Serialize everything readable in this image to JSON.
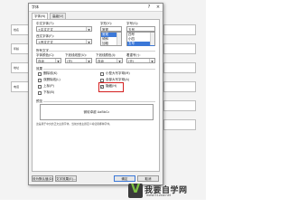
{
  "dialog": {
    "title": "字体",
    "help_btn": "?",
    "close_btn": "×",
    "tabs": [
      {
        "label": "字体(N)"
      },
      {
        "label": "高级(V)"
      }
    ]
  },
  "font_section": {
    "cjk_font_label": "中文字体(T):",
    "cjk_font_value": "+中文正文",
    "style_label": "字形(Y):",
    "style_value": "常规",
    "style_options": [
      "常规",
      "倾斜",
      "加粗"
    ],
    "size_label": "字号(S):",
    "size_value": "五号",
    "size_options": [
      "四号",
      "小四",
      "五号"
    ],
    "western_font_label": "西文字体(F):",
    "western_font_value": "+西文正文"
  },
  "all_text": {
    "group_label": "所有文字",
    "font_color_label": "字体颜色(C):",
    "font_color_value": "自动",
    "underline_label": "下划线线型(U):",
    "underline_value": "(无)",
    "underline_color_label": "下划线颜色(I):",
    "underline_color_value": "自动",
    "emphasis_label": "着重号(·):",
    "emphasis_value": "(无)"
  },
  "effects": {
    "group_label": "效果",
    "left": [
      {
        "label": "删除线(K)",
        "checked": false
      },
      {
        "label": "双删除线(L)",
        "checked": false
      },
      {
        "label": "上标(P)",
        "checked": false
      },
      {
        "label": "下标(B)",
        "checked": false
      }
    ],
    "right": [
      {
        "label": "小型大写字母(M)",
        "checked": false
      },
      {
        "label": "全部大写字母(A)",
        "checked": false
      },
      {
        "label": "隐藏(H)",
        "checked": true
      }
    ]
  },
  "preview": {
    "group_label": "预览",
    "sample_text": "微软卓越 AaBbCc",
    "hint": "这是用于中文的正文主题字体。当前文档主题定义将使用哪种字体。"
  },
  "buttons": {
    "set_default": "设为默认值(D)",
    "text_effects": "文字效果(E)...",
    "ok": "确定",
    "cancel": "取消"
  },
  "background_doc": {
    "cells": [
      "姓名",
      "年龄",
      "地址",
      "电话"
    ]
  },
  "watermark": {
    "brand": "我要自学网",
    "url": "www.51zxw.net",
    "logo_letter": "V"
  }
}
